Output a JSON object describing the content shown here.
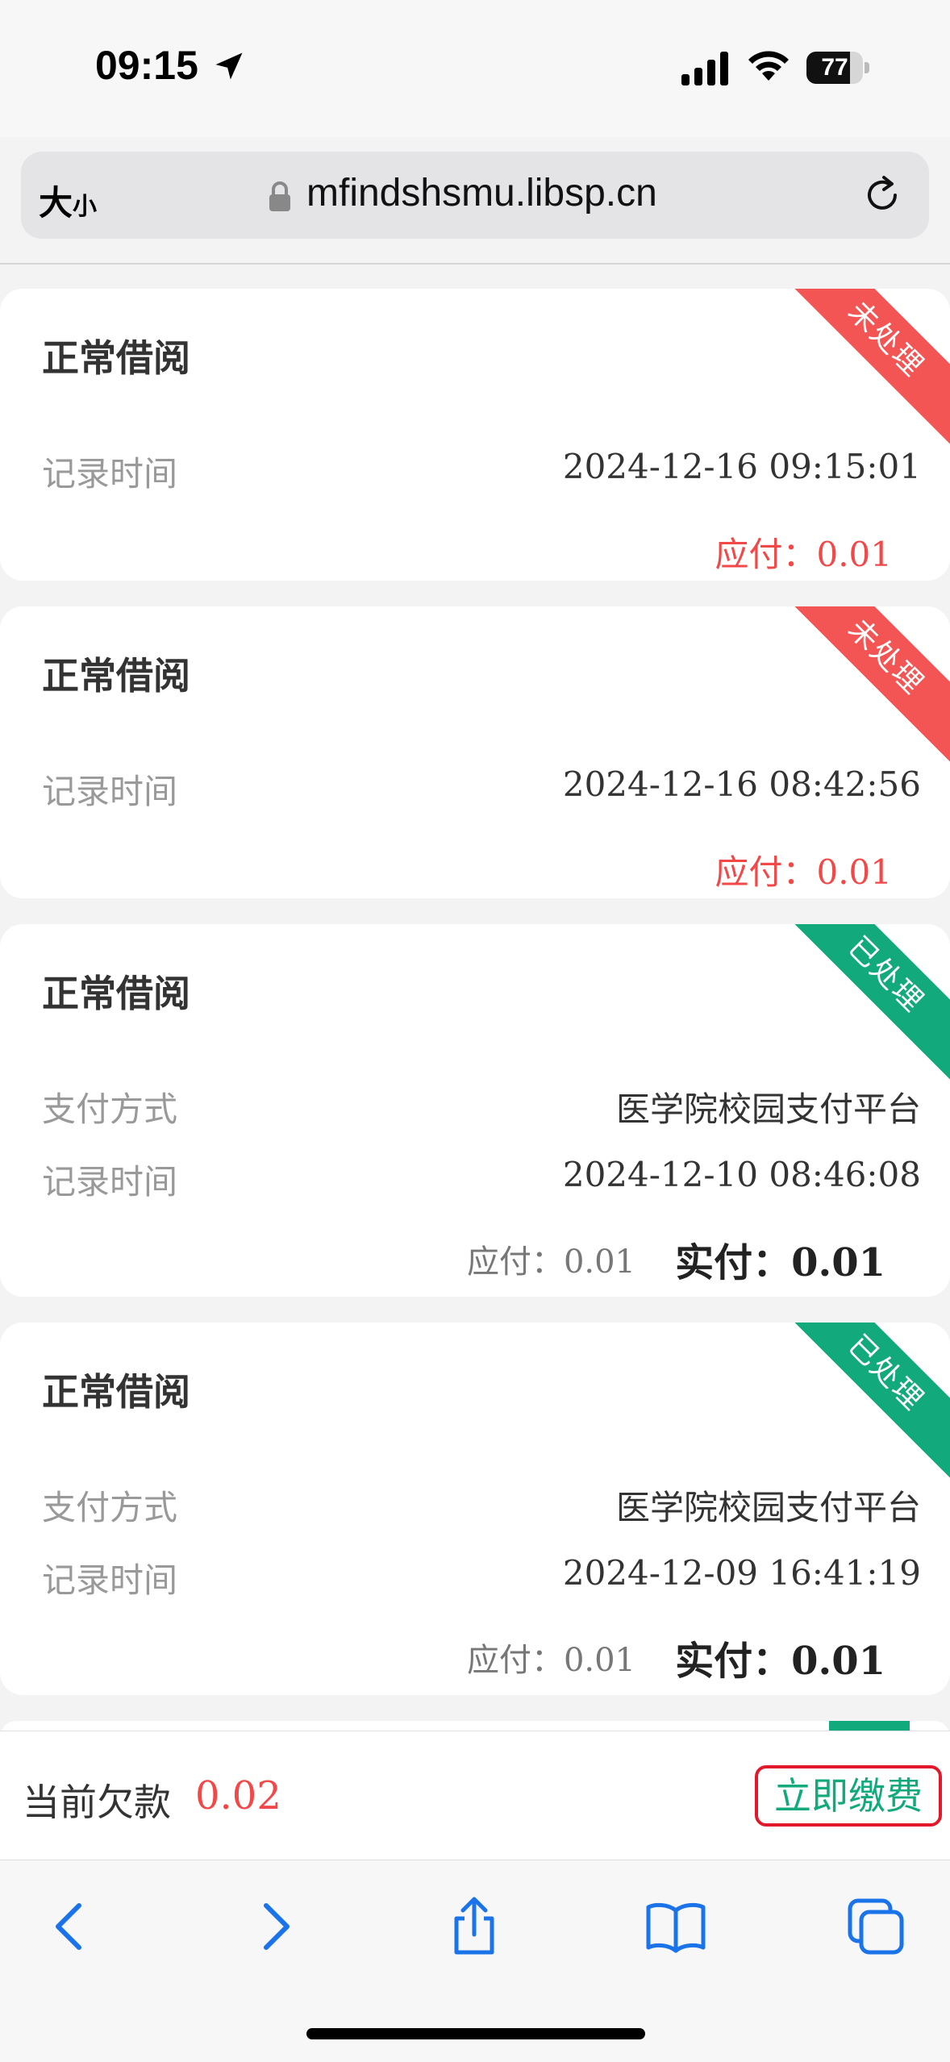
{
  "status_bar": {
    "time": "09:15",
    "battery_level": "77",
    "battery_fraction": 0.77
  },
  "browser": {
    "text_size_label": "大",
    "text_size_label_small": "小",
    "url": "mfindshsmu.libsp.cn"
  },
  "records": [
    {
      "title": "正常借阅",
      "status": "未处理",
      "status_color": "#f35555",
      "time_label": "记录时间",
      "time": "2024-12-16 09:15:01",
      "due_label": "应付：",
      "due": "0.01"
    },
    {
      "title": "正常借阅",
      "status": "未处理",
      "status_color": "#f35555",
      "time_label": "记录时间",
      "time": "2024-12-16 08:42:56",
      "due_label": "应付：",
      "due": "0.01"
    },
    {
      "title": "正常借阅",
      "status": "已处理",
      "status_color": "#12a97c",
      "method_label": "支付方式",
      "method": "医学院校园支付平台",
      "time_label": "记录时间",
      "time": "2024-12-10 08:46:08",
      "due_label": "应付：",
      "due": "0.01",
      "paid_label": "实付：",
      "paid": "0.01"
    },
    {
      "title": "正常借阅",
      "status": "已处理",
      "status_color": "#12a97c",
      "method_label": "支付方式",
      "method": "医学院校园支付平台",
      "time_label": "记录时间",
      "time": "2024-12-09 16:41:19",
      "due_label": "应付：",
      "due": "0.01",
      "paid_label": "实付：",
      "paid": "0.01"
    }
  ],
  "payment_bar": {
    "debt_label": "当前欠款",
    "debt_value": "0.02",
    "pay_button": "立即缴费"
  },
  "toolbar": {
    "icons": [
      "back-icon",
      "forward-icon",
      "share-icon",
      "bookmarks-icon",
      "tabs-icon"
    ],
    "accent": "#1a73e8"
  }
}
